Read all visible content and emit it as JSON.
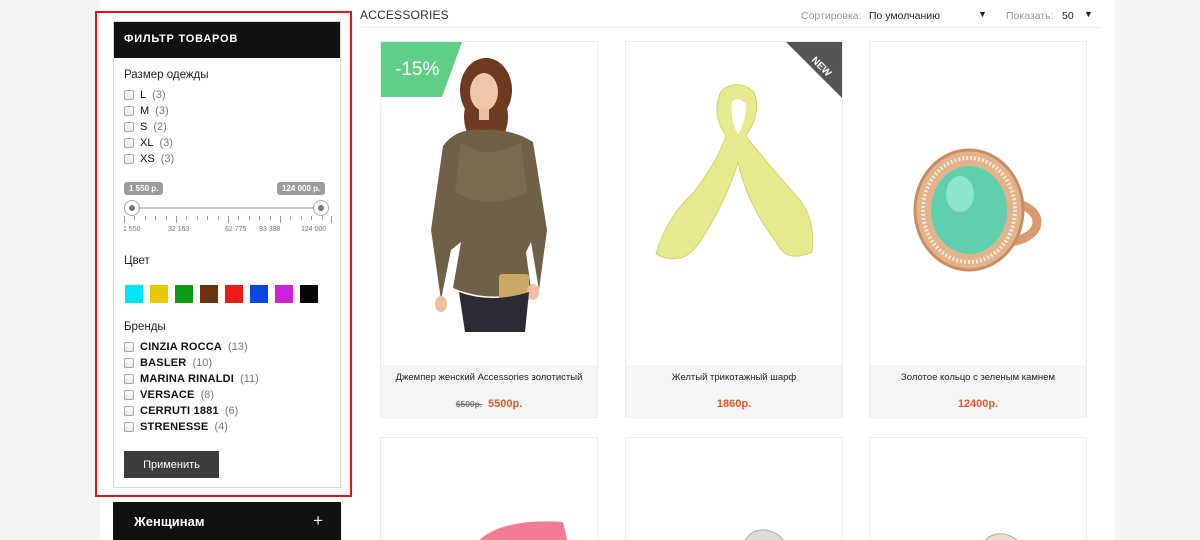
{
  "filter": {
    "title": "ФИЛЬТР ТОВАРОВ",
    "size_title": "Размер одежды",
    "sizes": [
      {
        "label": "L",
        "count": "(3)"
      },
      {
        "label": "M",
        "count": "(3)"
      },
      {
        "label": "S",
        "count": "(2)"
      },
      {
        "label": "XL",
        "count": "(3)"
      },
      {
        "label": "XS",
        "count": "(3)"
      }
    ],
    "price": {
      "min_label": "1 550 р.",
      "max_label": "124 000 р.",
      "ticks": [
        "1 550",
        "32 163",
        "62 775",
        "93 388",
        "124 000"
      ]
    },
    "color_title": "Цвет",
    "colors": [
      "#00e5ff",
      "#e8c900",
      "#109a1a",
      "#6b3310",
      "#ef1a1a",
      "#0a46e0",
      "#d020d8",
      "#050505"
    ],
    "brand_title": "Бренды",
    "brands": [
      {
        "label": "CINZIA ROCCA",
        "count": "(13)"
      },
      {
        "label": "BASLER",
        "count": "(10)"
      },
      {
        "label": "MARINA RINALDI",
        "count": "(11)"
      },
      {
        "label": "VERSACE",
        "count": "(8)"
      },
      {
        "label": "CERRUTI 1881",
        "count": "(6)"
      },
      {
        "label": "STRENESSE",
        "count": "(4)"
      }
    ],
    "apply_label": "Применить"
  },
  "menu": {
    "women_label": "Женщинам",
    "plus": "+"
  },
  "category": {
    "title": "ACCESSORIES"
  },
  "toolbar": {
    "sort_label": "Сортировка:",
    "sort_value": "По умолчанию",
    "show_label": "Показать:",
    "show_value": "50"
  },
  "products": [
    {
      "name": "Джемпер женский Accessories золотистый",
      "old_price": "6500р.",
      "price": "5500р.",
      "badge": "-15%"
    },
    {
      "name": "Желтый трикотажный шарф",
      "price": "1860р.",
      "badge": "NEW"
    },
    {
      "name": "Золотое кольцо с зеленым камнем",
      "price": "12400р."
    }
  ]
}
